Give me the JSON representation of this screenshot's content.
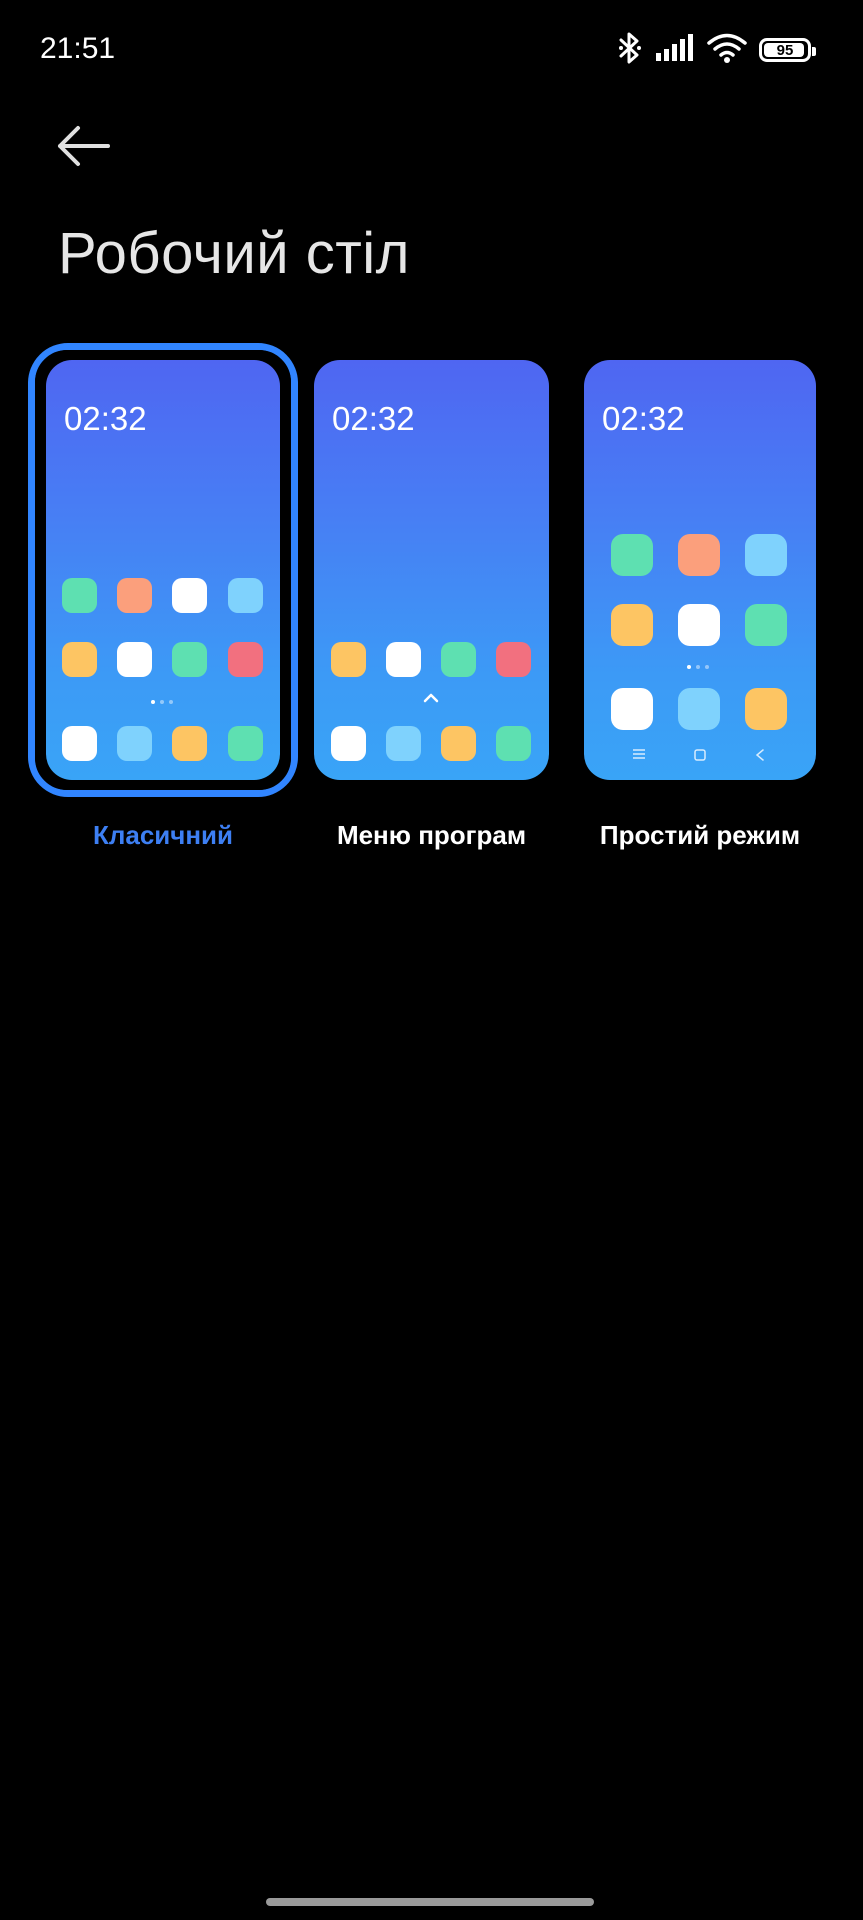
{
  "status_bar": {
    "time": "21:51",
    "battery_level": "95",
    "battery_fraction": 0.95,
    "icons": [
      "bluetooth-icon",
      "cellular-signal-icon",
      "wifi-icon",
      "battery-icon"
    ]
  },
  "header": {
    "back_icon": "arrow-left-icon",
    "title": "Робочий стіл"
  },
  "styles": [
    {
      "id": "classic",
      "label": "Класичний",
      "preview_time": "02:32",
      "selected": true
    },
    {
      "id": "app-drawer",
      "label": "Меню програм",
      "preview_time": "02:32",
      "selected": false
    },
    {
      "id": "simple-mode",
      "label": "Простий режим",
      "preview_time": "02:32",
      "selected": false
    }
  ],
  "colors": {
    "background": "#000000",
    "accent": "#3185ff",
    "selected_label": "#3d7ff3",
    "card_gradient_top": "#4f66f2",
    "card_gradient_bottom": "#39a4f7",
    "tile_green": "#5ee0b1",
    "tile_orange": "#fb9f7c",
    "tile_white": "#ffffff",
    "tile_lightblue": "#7fd2fd",
    "tile_yellow": "#fdc563",
    "tile_pink": "#f2707f"
  }
}
